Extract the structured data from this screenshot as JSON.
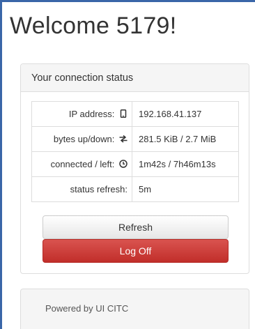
{
  "page": {
    "title": "Welcome 5179!"
  },
  "status_panel": {
    "heading": "Your connection status",
    "rows": [
      {
        "label": "IP address:",
        "icon": "phone-icon",
        "value": "192.168.41.137"
      },
      {
        "label": "bytes up/down:",
        "icon": "transfer-arrows-icon",
        "value": "281.5 KiB / 2.7 MiB"
      },
      {
        "label": "connected / left:",
        "icon": "clock-icon",
        "value": "1m42s / 7h46m13s"
      },
      {
        "label": "status refresh:",
        "icon": "",
        "value": "5m"
      }
    ],
    "refresh_label": "Refresh",
    "logoff_label": "Log Off"
  },
  "footer": {
    "text": "Powered by UI CITC"
  },
  "colors": {
    "frame": "#3a66a8",
    "logoff_button": "#d9534f",
    "panel_heading_bg": "#f5f5f5"
  }
}
